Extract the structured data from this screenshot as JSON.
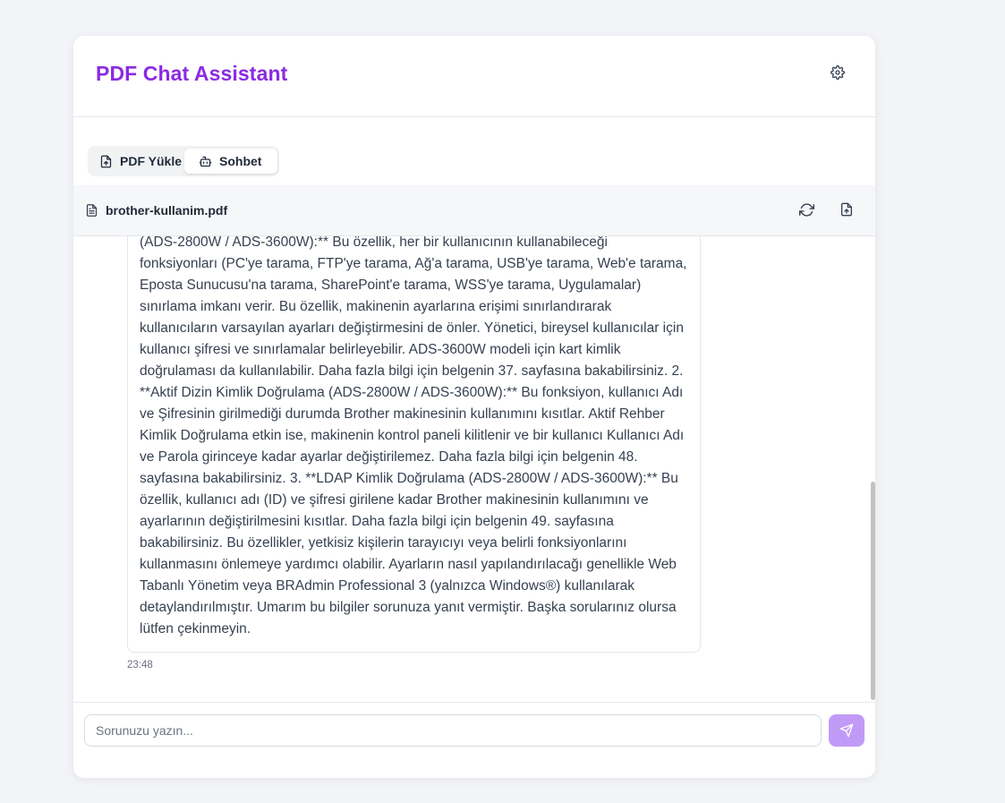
{
  "app": {
    "title": "PDF Chat Assistant"
  },
  "tabs": [
    {
      "label": "PDF Yükle",
      "icon": "file-upload-icon",
      "active": false
    },
    {
      "label": "Sohbet",
      "icon": "bot-icon",
      "active": true
    }
  ],
  "file": {
    "name": "brother-kullanim.pdf"
  },
  "message": {
    "text": "(ADS-2800W / ADS-3600W):** Bu özellik, her bir kullanıcının kullanabileceği fonksiyonları (PC'ye tarama, FTP'ye tarama, Ağ'a tarama, USB'ye tarama, Web'e tarama, Eposta Sunucusu'na tarama, SharePoint'e tarama, WSS'ye tarama, Uygulamalar) sınırlama imkanı verir. Bu özellik, makinenin ayarlarına erişimi sınırlandırarak kullanıcıların varsayılan ayarları değiştirmesini de önler. Yönetici, bireysel kullanıcılar için kullanıcı şifresi ve sınırlamalar belirleyebilir. ADS-3600W modeli için kart kimlik doğrulaması da kullanılabilir. Daha fazla bilgi için belgenin 37. sayfasına bakabilirsiniz. 2. **Aktif Dizin Kimlik Doğrulama (ADS-2800W / ADS-3600W):** Bu fonksiyon, kullanıcı Adı ve Şifresinin girilmediği durumda Brother makinesinin kullanımını kısıtlar. Aktif Rehber Kimlik Doğrulama etkin ise, makinenin kontrol paneli kilitlenir ve bir kullanıcı Kullanıcı Adı ve Parola girinceye kadar ayarlar değiştirilemez. Daha fazla bilgi için belgenin 48. sayfasına bakabilirsiniz. 3. **LDAP Kimlik Doğrulama (ADS-2800W / ADS-3600W):** Bu özellik, kullanıcı adı (ID) ve şifresi girilene kadar Brother makinesinin kullanımını ve ayarlarının değiştirilmesini kısıtlar. Daha fazla bilgi için belgenin 49. sayfasına bakabilirsiniz. Bu özellikler, yetkisiz kişilerin tarayıcıyı veya belirli fonksiyonlarını kullanmasını önlemeye yardımcı olabilir. Ayarların nasıl yapılandırılacağı genellikle Web Tabanlı Yönetim veya BRAdmin Professional 3 (yalnızca Windows®) kullanılarak detaylandırılmıştır. Umarım bu bilgiler sorunuza yanıt vermiştir. Başka sorularınız olursa lütfen çekinmeyin.",
    "time": "23:48"
  },
  "composer": {
    "placeholder": "Sorunuzu yazın...",
    "value": ""
  },
  "colors": {
    "accent": "#8a2be2",
    "send_button": "#c19af7"
  },
  "icons": {
    "settings": "gear-icon",
    "file": "file-text-icon",
    "refresh": "refresh-icon",
    "export": "file-upload-icon",
    "send": "send-icon"
  }
}
